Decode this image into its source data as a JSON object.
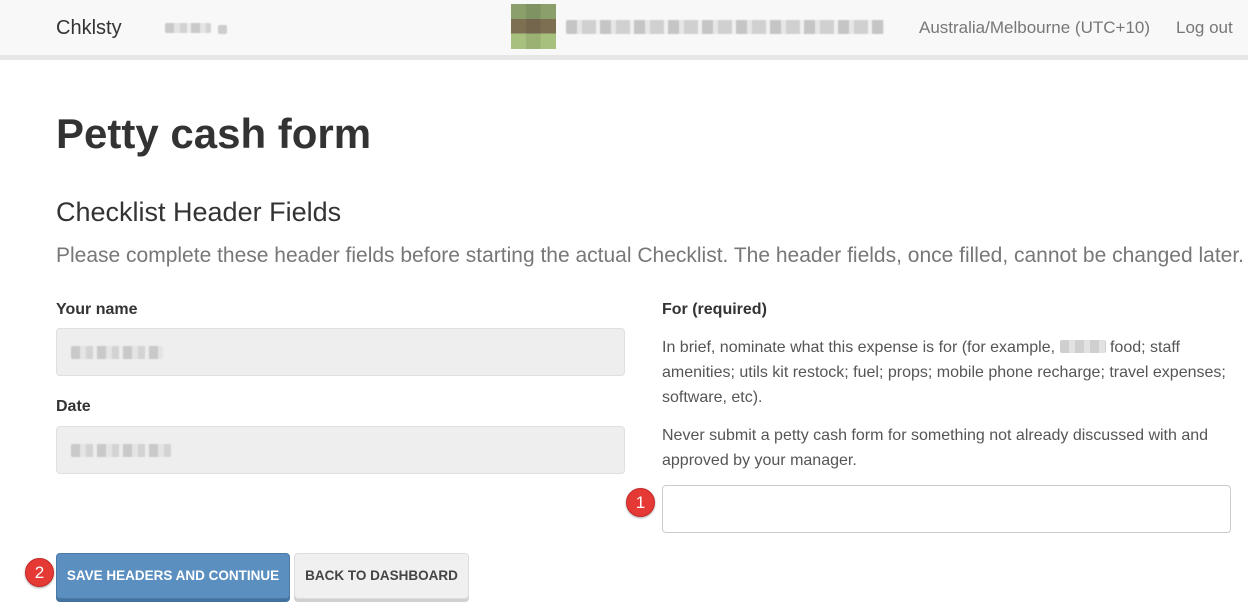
{
  "navbar": {
    "brand": "Chklsty",
    "timezone": "Australia/Melbourne (UTC+10)",
    "logout_label": "Log out"
  },
  "page": {
    "title": "Petty cash form",
    "section_title": "Checklist Header Fields",
    "lead": "Please complete these header fields before starting the actual Checklist. The header fields, once filled, cannot be changed later."
  },
  "form": {
    "your_name_label": "Your name",
    "date_label": "Date",
    "for_label": "For (required)",
    "for_help_1_before": "In brief, nominate what this expense is for (for example, ",
    "for_help_1_after": " food; staff amenities; utils kit restock; fuel; props; mobile phone recharge; travel expenses; software, etc).",
    "for_help_2": "Never submit a petty cash form for something not already discussed with and approved by your manager.",
    "for_value": ""
  },
  "markers": {
    "one": "1",
    "two": "2"
  },
  "buttons": {
    "save_label": "SAVE HEADERS AND CONTINUE",
    "back_label": "BACK TO DASHBOARD"
  },
  "colors": {
    "primary": "#5b8fc0",
    "marker": "#e53935"
  }
}
